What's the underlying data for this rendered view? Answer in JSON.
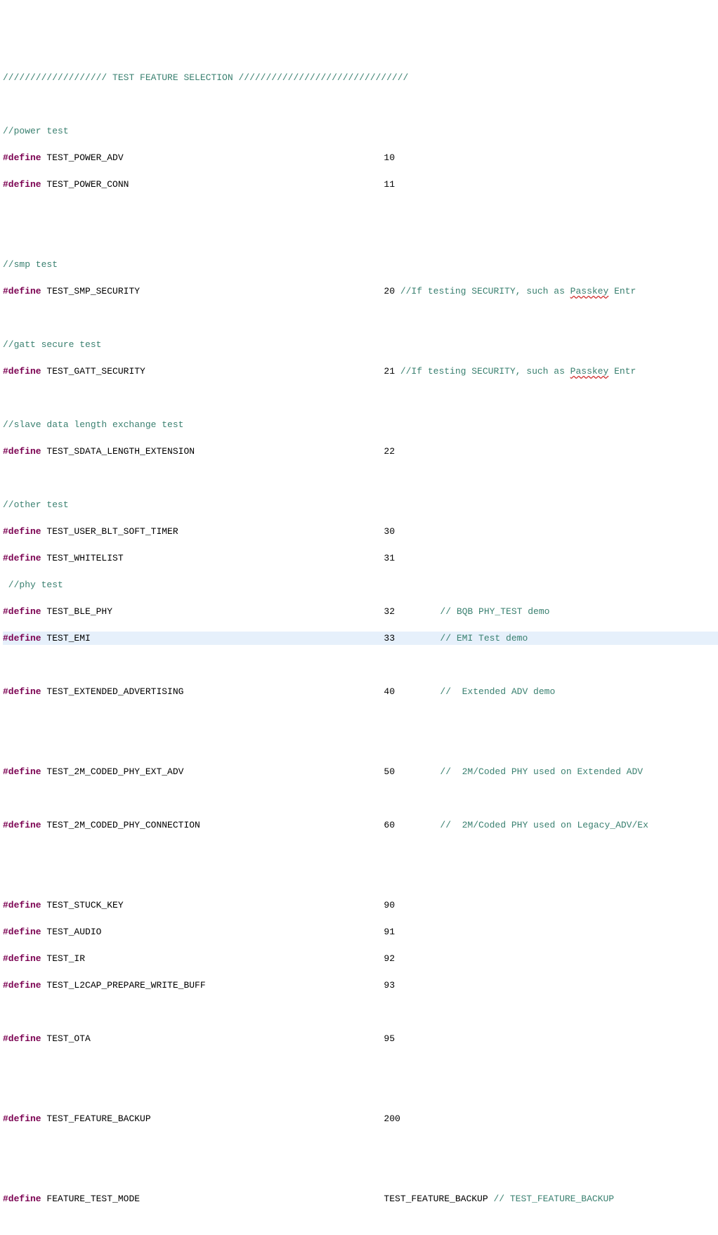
{
  "header": {
    "slashesL": "///////////////////",
    "title": " TEST FEATURE SELECTION ",
    "slashesR": "///////////////////////////////"
  },
  "sections": {
    "power": "//power test",
    "smp": "//smp test",
    "gatt": "//gatt secure test",
    "slave": "//slave data length exchange test",
    "other": "//other test",
    "phy": " //phy test"
  },
  "defs": {
    "power_adv": {
      "name": "TEST_POWER_ADV",
      "val": "10"
    },
    "power_conn": {
      "name": "TEST_POWER_CONN",
      "val": "11"
    },
    "smp_sec": {
      "name": "TEST_SMP_SECURITY",
      "val": "20",
      "c1": " //If testing SECURITY, such as ",
      "link": "Passkey",
      "c2": " Entr"
    },
    "gatt_sec": {
      "name": "TEST_GATT_SECURITY",
      "val": "21",
      "c1": " //If testing SECURITY, such as ",
      "link": "Passkey",
      "c2": " Entr"
    },
    "sdata": {
      "name": "TEST_SDATA_LENGTH_EXTENSION",
      "val": "22"
    },
    "user_timer": {
      "name": "TEST_USER_BLT_SOFT_TIMER",
      "val": "30"
    },
    "whitelist": {
      "name": "TEST_WHITELIST",
      "val": "31"
    },
    "ble_phy": {
      "name": "TEST_BLE_PHY",
      "val": "32",
      "c": "// BQB PHY_TEST demo"
    },
    "emi": {
      "name": "TEST_EMI",
      "val": "33",
      "c": "// EMI Test demo"
    },
    "ext_adv": {
      "name": "TEST_EXTENDED_ADVERTISING",
      "val": "40",
      "c": "//  Extended ADV demo"
    },
    "m2_ext": {
      "name": "TEST_2M_CODED_PHY_EXT_ADV",
      "val": "50",
      "c": "//  2M/Coded PHY used on Extended ADV "
    },
    "m2_conn": {
      "name": "TEST_2M_CODED_PHY_CONNECTION",
      "val": "60",
      "c": "//  2M/Coded PHY used on Legacy_ADV/Ex"
    },
    "stuck": {
      "name": "TEST_STUCK_KEY",
      "val": "90"
    },
    "audio": {
      "name": "TEST_AUDIO",
      "val": "91"
    },
    "ir": {
      "name": "TEST_IR",
      "val": "92"
    },
    "l2cap": {
      "name": "TEST_L2CAP_PREPARE_WRITE_BUFF",
      "val": "93"
    },
    "ota": {
      "name": "TEST_OTA",
      "val": "95"
    },
    "backup": {
      "name": "TEST_FEATURE_BACKUP",
      "val": "200"
    },
    "mode": {
      "name": "FEATURE_TEST_MODE",
      "val": "TEST_FEATURE_BACKUP",
      "c": " // TEST_FEATURE_BACKUP"
    }
  },
  "kw": "#define"
}
